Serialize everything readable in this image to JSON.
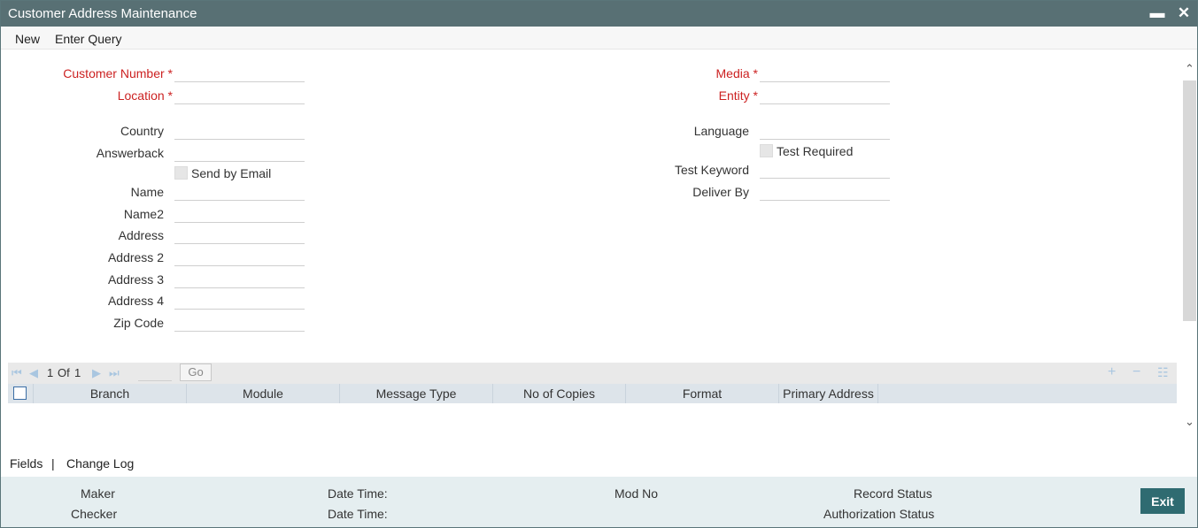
{
  "window": {
    "title": "Customer Address Maintenance",
    "minimize_glyph": "▬",
    "close_glyph": "✕"
  },
  "menu": {
    "new_label": "New",
    "enter_query_label": "Enter Query"
  },
  "form": {
    "required_star": "*",
    "customer_number_label": "Customer Number",
    "location_label": "Location",
    "media_label": "Media",
    "entity_label": "Entity",
    "country_label": "Country",
    "answerback_label": "Answerback",
    "send_by_email_label": "Send by Email",
    "name_label": "Name",
    "name2_label": "Name2",
    "address_label": "Address",
    "address2_label": "Address 2",
    "address3_label": "Address 3",
    "address4_label": "Address 4",
    "zip_code_label": "Zip Code",
    "language_label": "Language",
    "test_required_label": "Test Required",
    "test_keyword_label": "Test Keyword",
    "deliver_by_label": "Deliver By"
  },
  "grid": {
    "page_current": "1",
    "page_of": "Of",
    "page_total": "1",
    "go_label": "Go",
    "columns": [
      "Branch",
      "Module",
      "Message Type",
      "No of Copies",
      "Format",
      "Primary Address"
    ]
  },
  "footer": {
    "fields_label": "Fields",
    "separator": "|",
    "change_log_label": "Change Log"
  },
  "audit": {
    "maker_label": "Maker",
    "checker_label": "Checker",
    "date_time_label_1": "Date Time:",
    "date_time_label_2": "Date Time:",
    "mod_no_label": "Mod No",
    "record_status_label": "Record Status",
    "authorization_status_label": "Authorization Status",
    "exit_label": "Exit"
  },
  "colors": {
    "titlebar": "#587074",
    "required": "#cc2222",
    "grid_header": "#dde4ea",
    "audit_bg": "#e5eef0",
    "exit_button": "#2f6b71"
  }
}
